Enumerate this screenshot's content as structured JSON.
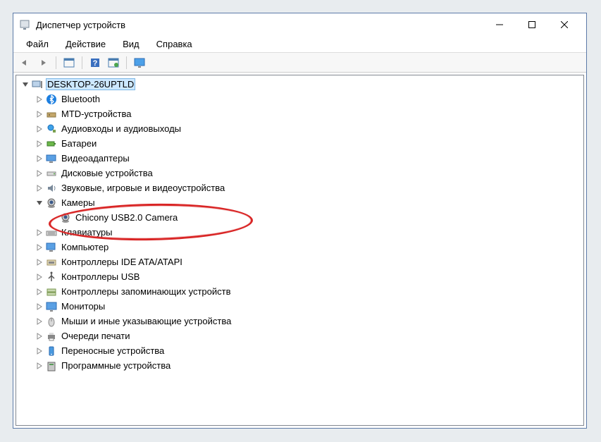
{
  "window": {
    "title": "Диспетчер устройств"
  },
  "menu": {
    "file": "Файл",
    "action": "Действие",
    "view": "Вид",
    "help": "Справка"
  },
  "toolbar": {
    "back": "back",
    "forward": "forward",
    "show_hidden": "show-hidden",
    "help": "help",
    "scan": "scan-hardware",
    "monitor": "monitor"
  },
  "root": {
    "name": "DESKTOP-26UPTLD",
    "expanded": true
  },
  "categories": [
    {
      "label": "Bluetooth",
      "icon": "bluetooth"
    },
    {
      "label": "MTD-устройства",
      "icon": "mtd"
    },
    {
      "label": "Аудиовходы и аудиовыходы",
      "icon": "audio"
    },
    {
      "label": "Батареи",
      "icon": "battery"
    },
    {
      "label": "Видеоадаптеры",
      "icon": "display"
    },
    {
      "label": "Дисковые устройства",
      "icon": "disk"
    },
    {
      "label": "Звуковые, игровые и видеоустройства",
      "icon": "sound"
    },
    {
      "label": "Камеры",
      "icon": "camera",
      "expanded": true,
      "children": [
        {
          "label": "Chicony USB2.0 Camera",
          "icon": "camera"
        }
      ]
    },
    {
      "label": "Клавиатуры",
      "icon": "keyboard"
    },
    {
      "label": "Компьютер",
      "icon": "computer"
    },
    {
      "label": "Контроллеры IDE ATA/ATAPI",
      "icon": "ide"
    },
    {
      "label": "Контроллеры USB",
      "icon": "usb"
    },
    {
      "label": "Контроллеры запоминающих устройств",
      "icon": "storage"
    },
    {
      "label": "Мониторы",
      "icon": "monitor"
    },
    {
      "label": "Мыши и иные указывающие устройства",
      "icon": "mouse"
    },
    {
      "label": "Очереди печати",
      "icon": "printer"
    },
    {
      "label": "Переносные устройства",
      "icon": "portable"
    },
    {
      "label": "Программные устройства",
      "icon": "software"
    }
  ]
}
